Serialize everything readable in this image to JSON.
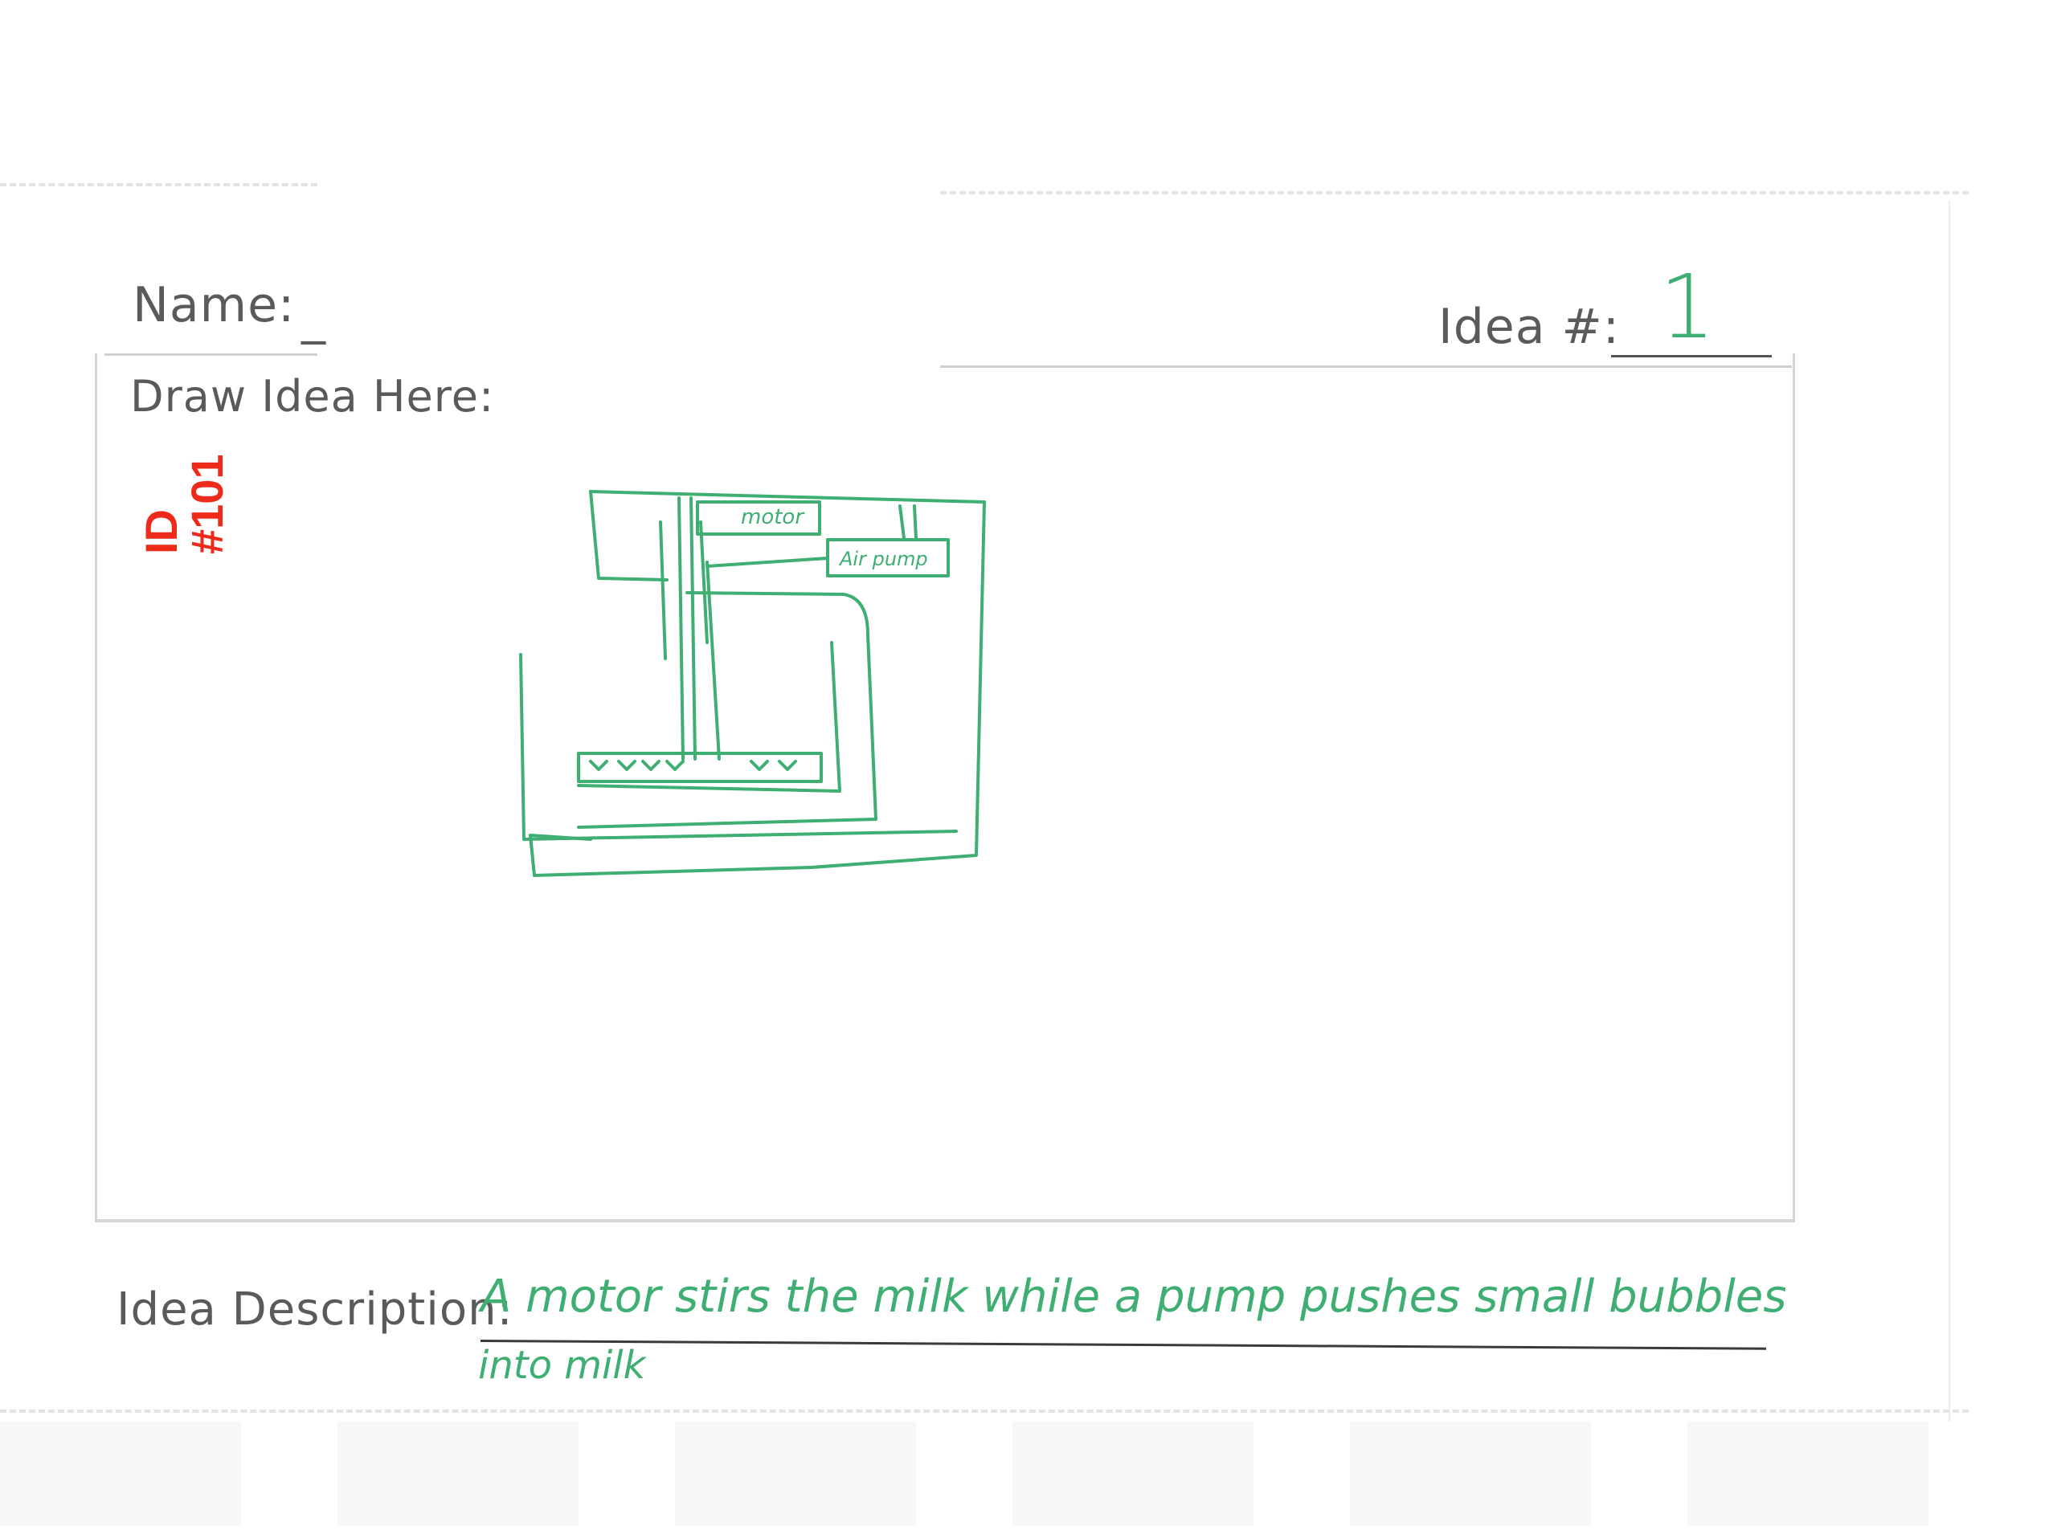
{
  "form": {
    "name_label": "Name:",
    "name_value": "_",
    "idea_number_label": "Idea #:",
    "idea_number_value": "1",
    "draw_label": "Draw Idea Here:",
    "description_label": "Idea Description:",
    "description_line1": "A motor stirs the milk while a pump pushes small bubbles",
    "description_line2": "into milk"
  },
  "stamp": {
    "id_label": "ID",
    "id_value": "#101",
    "color": "#ee2a1a"
  },
  "sketch": {
    "motor_label": "motor",
    "pump_label": "Air pump",
    "ink_color": "#3fae72"
  }
}
